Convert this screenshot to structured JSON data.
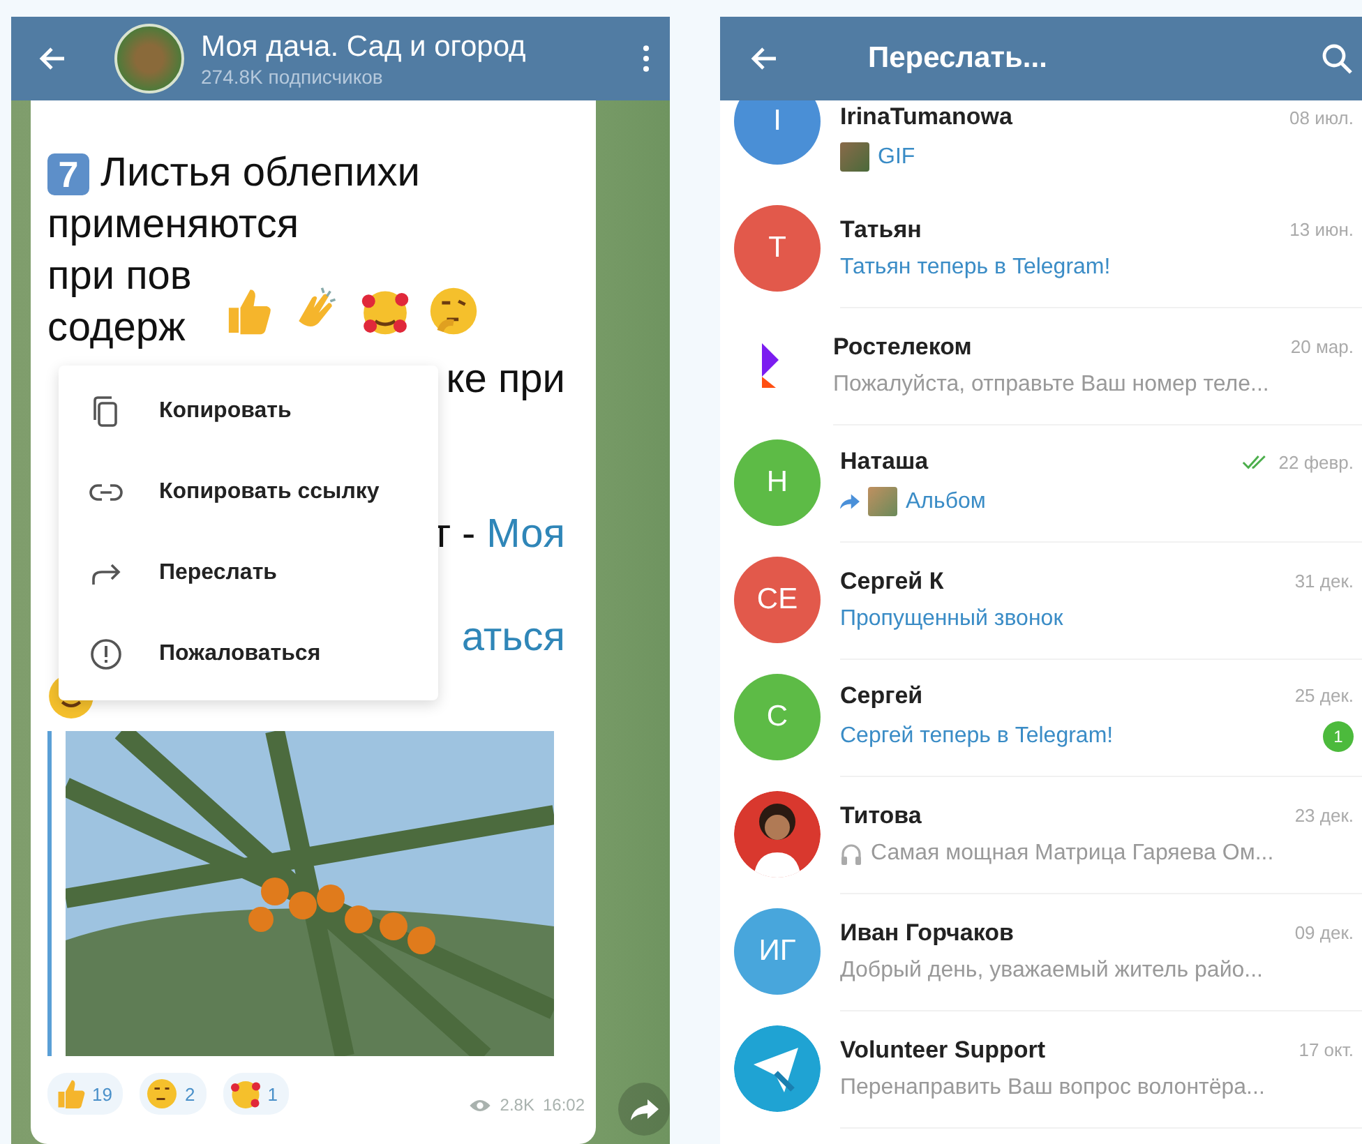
{
  "channel": {
    "title": "Моя дача. Сад и огород",
    "subtitle": "274.8K подписчиков"
  },
  "message": {
    "badge": "7",
    "heading": "Листья облепихи",
    "rows": [
      {
        "left": [
          {
            "text": "применяются",
            "link": false
          }
        ],
        "right": []
      },
      {
        "left": [
          {
            "text": "при пов",
            "link": false
          }
        ],
        "right": []
      },
      {
        "left": [
          {
            "text": "содерж",
            "link": false
          }
        ],
        "right": []
      },
      {
        "left": [],
        "right": [
          {
            "text": "ке при",
            "link": false
          }
        ]
      },
      {
        "left": [],
        "right": []
      },
      {
        "left": [],
        "right": []
      },
      {
        "left": [],
        "right": [
          {
            "text": "т -",
            "link": false
          },
          {
            "text": "Моя",
            "link": true
          }
        ]
      },
      {
        "left": [],
        "right": []
      },
      {
        "left": [],
        "right": [
          {
            "text": "аться",
            "link": true
          }
        ]
      }
    ],
    "reactions": [
      {
        "kind": "thumbs-up",
        "count": "19"
      },
      {
        "kind": "thinking",
        "count": "2"
      },
      {
        "kind": "hearts",
        "count": "1"
      }
    ],
    "views": "2.8K",
    "time": "16:02"
  },
  "reaction_picker": [
    {
      "kind": "thumbs-up"
    },
    {
      "kind": "clap"
    },
    {
      "kind": "hearts"
    },
    {
      "kind": "thinking"
    }
  ],
  "context_menu": [
    {
      "kind": "copy",
      "label": "Копировать"
    },
    {
      "kind": "link",
      "label": "Копировать ссылку"
    },
    {
      "kind": "forward",
      "label": "Переслать"
    },
    {
      "kind": "report",
      "label": "Пожаловаться"
    }
  ],
  "forward": {
    "title": "Переслать...",
    "chats": [
      {
        "name": "IrinaTumanowa",
        "date": "08 июл.",
        "read": false,
        "avatar": {
          "kind": "initials",
          "text": "I",
          "color": "#4a8fd6"
        },
        "preview": {
          "text": "GIF",
          "kind": "gif"
        }
      },
      {
        "name": "Татьян",
        "date": "13 июн.",
        "read": false,
        "avatar": {
          "kind": "initials",
          "text": "T",
          "color": "#e2594b"
        },
        "preview": {
          "text": "Татьян теперь в Telegram!",
          "kind": "service"
        }
      },
      {
        "name": "Ростелеком",
        "date": "20 мар.",
        "read": false,
        "avatar": {
          "kind": "logo"
        },
        "preview": {
          "text": "Пожалуйста, отправьте Ваш номер теле...",
          "kind": "text"
        }
      },
      {
        "name": "Наташа",
        "date": "22 февр.",
        "read": true,
        "avatar": {
          "kind": "initials",
          "text": "H",
          "color": "#5dbb46"
        },
        "preview": {
          "text": "Альбом",
          "kind": "forwarded-album"
        }
      },
      {
        "name": "Сергей К",
        "date": "31 дек.",
        "read": false,
        "avatar": {
          "kind": "initials",
          "text": "CE",
          "color": "#e2594b"
        },
        "preview": {
          "text": "Пропущенный звонок",
          "kind": "call"
        }
      },
      {
        "name": "Сергей",
        "date": "25 дек.",
        "read": false,
        "unread": "1",
        "avatar": {
          "kind": "initials",
          "text": "C",
          "color": "#5dbb46"
        },
        "preview": {
          "text": "Сергей теперь в Telegram!",
          "kind": "service"
        }
      },
      {
        "name": "Титова",
        "date": "23 дек.",
        "read": false,
        "avatar": {
          "kind": "person",
          "color": "#d9382e"
        },
        "preview": {
          "text": "Самая мощная Матрица Гаряева Ом...",
          "kind": "audio"
        }
      },
      {
        "name": "Иван Горчаков",
        "date": "09 дек.",
        "read": false,
        "avatar": {
          "kind": "initials",
          "text": "ИГ",
          "color": "#48a6dc"
        },
        "preview": {
          "text": "Добрый день, уважаемый житель  райо...",
          "kind": "text"
        }
      },
      {
        "name": "Volunteer Support",
        "date": "17 окт.",
        "read": false,
        "avatar": {
          "kind": "tools",
          "color": "#1fa3d3"
        },
        "preview": {
          "text": "Перенаправить Ваш вопрос волонтёра...",
          "kind": "text"
        }
      }
    ]
  }
}
